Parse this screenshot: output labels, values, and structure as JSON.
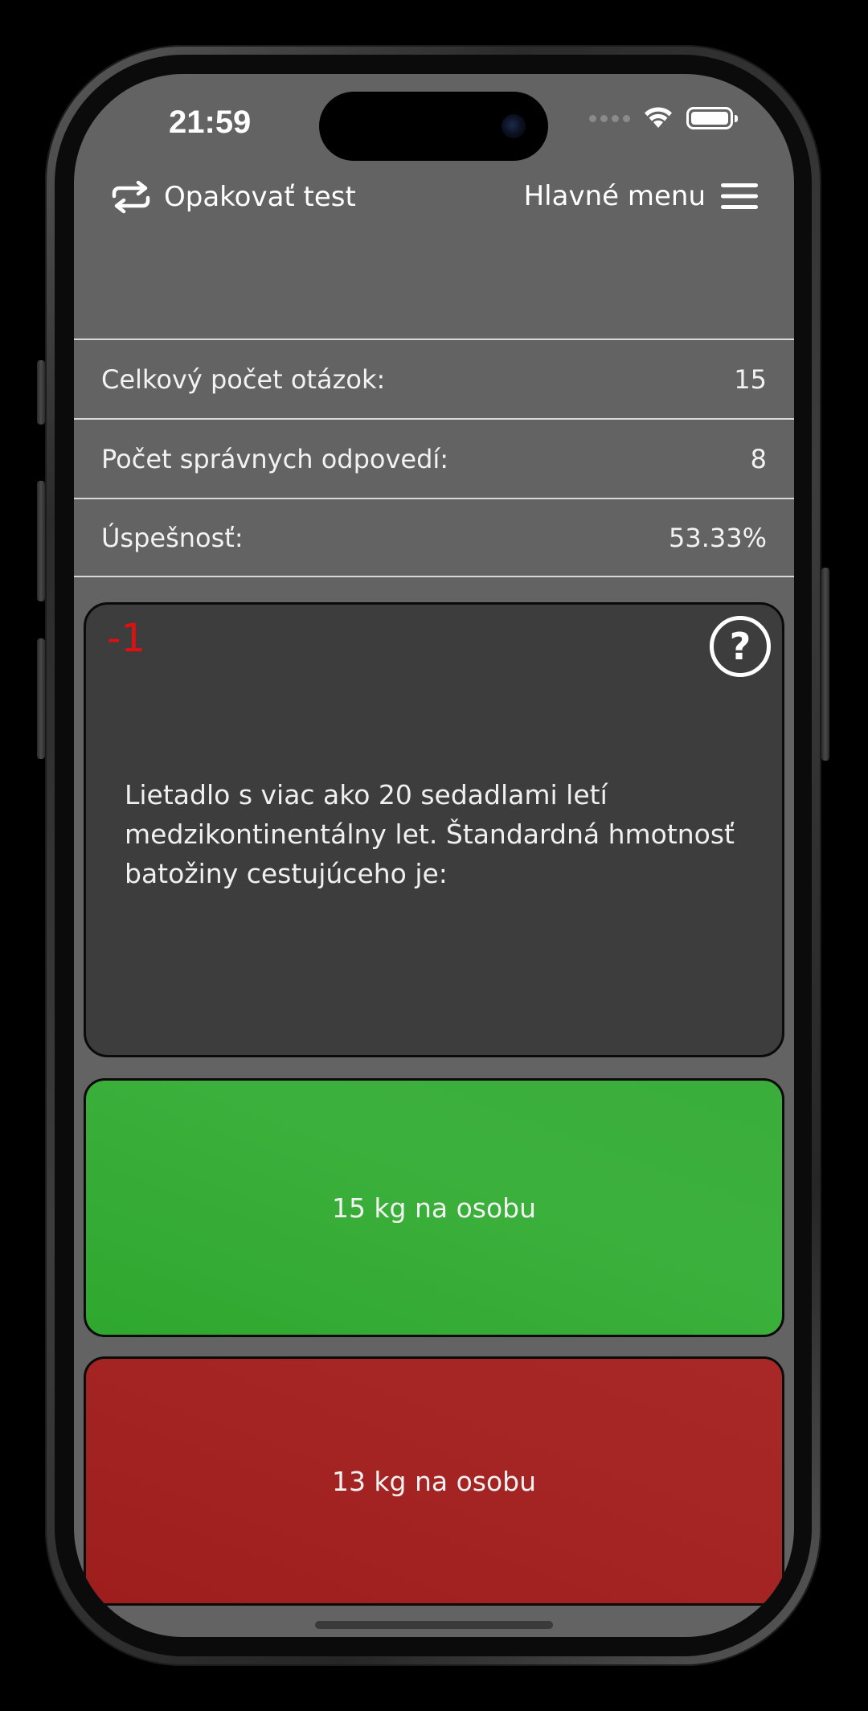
{
  "status_bar": {
    "time": "21:59"
  },
  "nav": {
    "repeat_label": "Opakovať test",
    "menu_label": "Hlavné menu"
  },
  "stats": {
    "total_label": "Celkový počet otázok:",
    "total_value": "15",
    "correct_label": "Počet správnych odpovedí:",
    "correct_value": "8",
    "success_label": "Úspešnosť:",
    "success_value": "53.33%"
  },
  "question": {
    "score": "-1",
    "help_symbol": "?",
    "text": "Lietadlo s viac ako 20 sedadlami letí medzikontinentálny let. Štandardná hmotnosť batožiny cestujúceho je:"
  },
  "answers": [
    {
      "label": "15 kg na osobu",
      "state": "correct",
      "color": "#37ad37"
    },
    {
      "label": "13 kg na osobu",
      "state": "wrong",
      "color": "#a32424"
    }
  ],
  "icons": {
    "repeat": "repeat-icon",
    "menu": "hamburger-menu-icon",
    "wifi": "wifi-icon",
    "battery": "battery-icon",
    "help": "question-circle-icon"
  }
}
